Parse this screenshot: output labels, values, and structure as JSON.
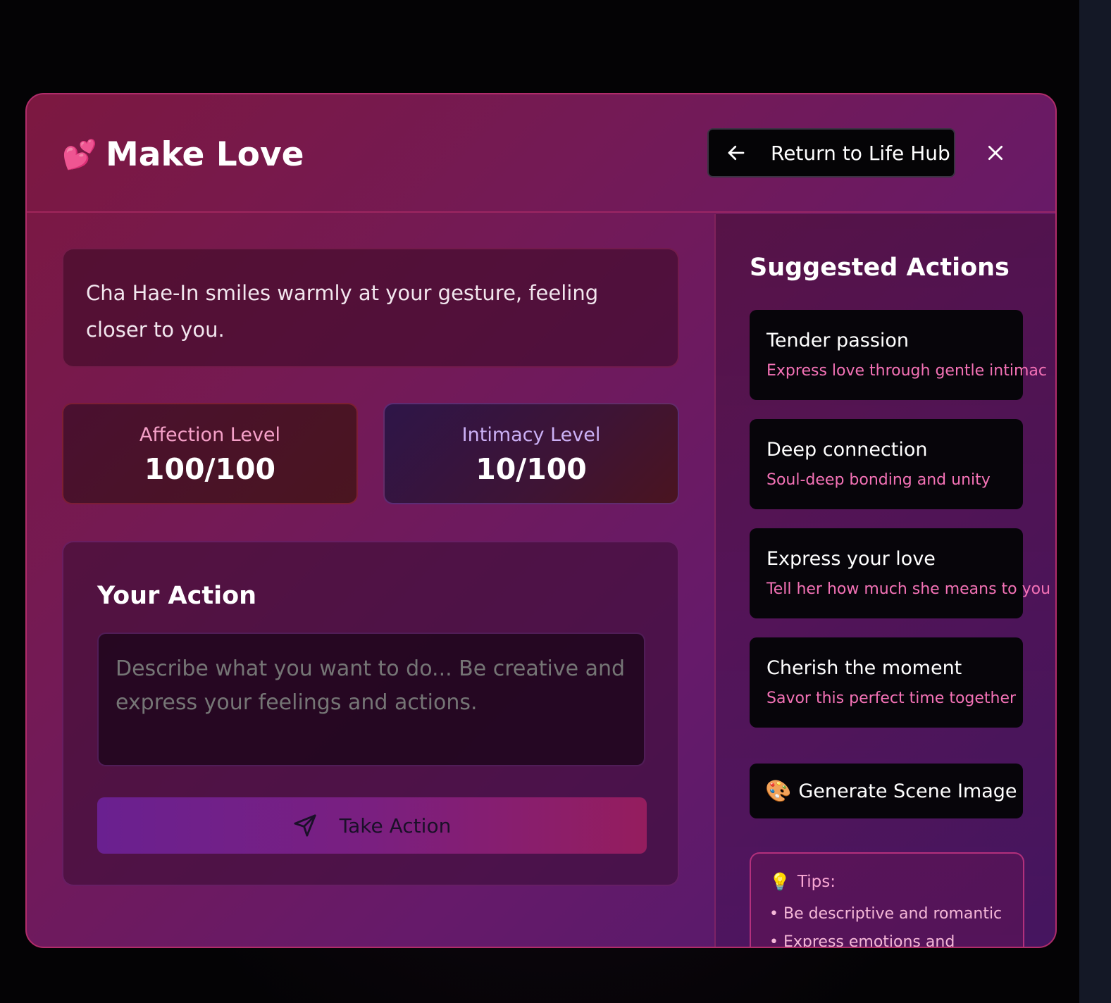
{
  "modal": {
    "title_emoji": "💕",
    "title": "Make Love",
    "return_button_label": "Return to Life Hub"
  },
  "narrative": {
    "text": "Cha Hae-In smiles warmly at your gesture, feeling closer to you."
  },
  "stats": {
    "affection": {
      "label": "Affection Level",
      "value": "100/100"
    },
    "intimacy": {
      "label": "Intimacy Level",
      "value": "10/100"
    }
  },
  "action": {
    "title": "Your Action",
    "placeholder": "Describe what you want to do... Be creative and express your feelings and actions.",
    "submit_label": "Take Action"
  },
  "suggestions": {
    "title": "Suggested Actions",
    "items": [
      {
        "title": "Tender passion",
        "description": "Express love through gentle intimac"
      },
      {
        "title": "Deep connection",
        "description": "Soul-deep bonding and unity"
      },
      {
        "title": "Express your love",
        "description": "Tell her how much she means to you"
      },
      {
        "title": "Cherish the moment",
        "description": "Savor this perfect time together"
      }
    ],
    "generate_emoji": "🎨",
    "generate_label": "Generate Scene Image"
  },
  "tips": {
    "emoji": "💡",
    "heading": "Tips:",
    "items": [
      "• Be descriptive and romantic",
      "• Express emotions and"
    ]
  },
  "colors": {
    "accent_pink": "#f472b6",
    "border_pink": "#b02c6a",
    "button_gradient_start": "#6a2090",
    "button_gradient_end": "#951d5e"
  },
  "icons": {
    "back": "arrow-left-icon",
    "close": "close-icon",
    "send": "send-icon"
  }
}
